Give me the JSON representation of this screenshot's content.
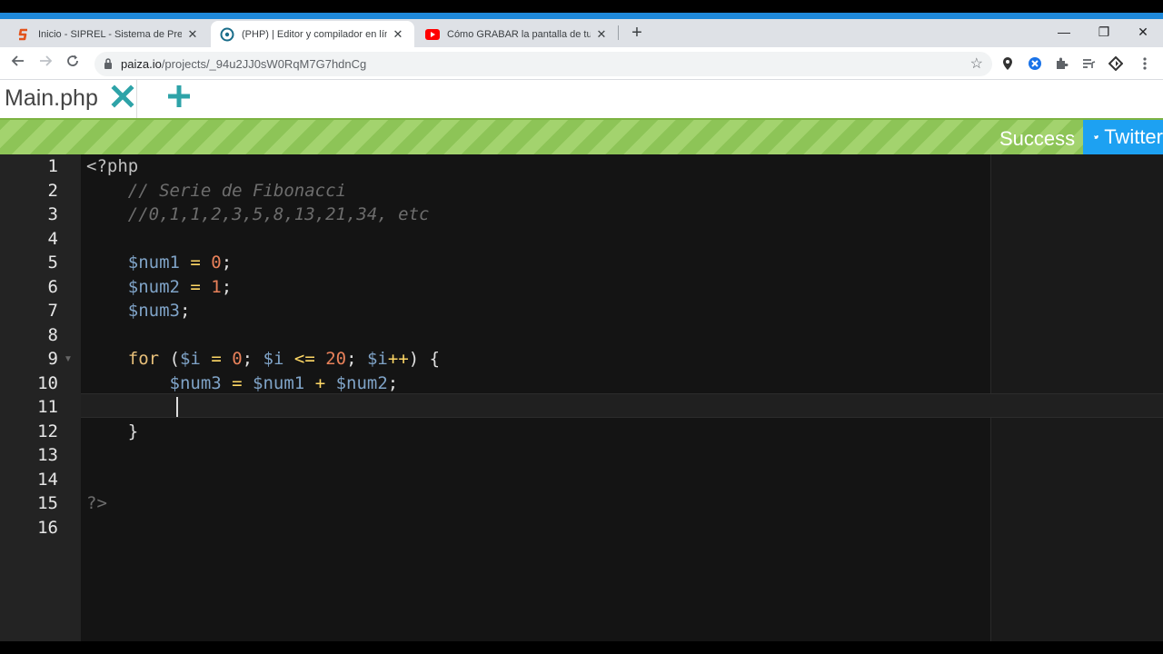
{
  "browser": {
    "tabs": [
      {
        "title": "Inicio - SIPREL - Sistema de Prep",
        "close": "✕"
      },
      {
        "title": "(PHP) | Editor y compilador en lín",
        "close": "✕"
      },
      {
        "title": "Cómo GRABAR la pantalla de tu",
        "close": "✕"
      }
    ],
    "new_tab": "+",
    "url_domain": "paiza.io",
    "url_path": "/projects/_94u2JJ0sW0RqM7G7hdnCg",
    "controls": {
      "minimize": "—",
      "restore": "❐",
      "close": "✕"
    }
  },
  "editor": {
    "file_name": "Main.php",
    "status": "Success",
    "twitter_label": "Twitter",
    "line_numbers": [
      "1",
      "2",
      "3",
      "4",
      "5",
      "6",
      "7",
      "8",
      "9",
      "10",
      "11",
      "12",
      "13",
      "14",
      "15",
      "16"
    ],
    "code": {
      "l1": "<?php",
      "l2": "    // Serie de Fibonacci",
      "l3": "    //0,1,1,2,3,5,8,13,21,34, etc",
      "l5_var": "$num1",
      "l5_op": " = ",
      "l5_num": "0",
      "l5_end": ";",
      "l6_var": "$num2",
      "l6_op": " = ",
      "l6_num": "1",
      "l6_end": ";",
      "l7_var": "$num3",
      "l7_end": ";",
      "l9_kw": "for",
      "l9_a": " (",
      "l9_v1": "$i",
      "l9_o1": " = ",
      "l9_n1": "0",
      "l9_b": "; ",
      "l9_v2": "$i",
      "l9_o2": " <= ",
      "l9_n2": "20",
      "l9_c": "; ",
      "l9_v3": "$i",
      "l9_o3": "++",
      "l9_d": ") {",
      "l10_v1": "$num3",
      "l10_o1": " = ",
      "l10_v2": "$num1",
      "l10_o2": " + ",
      "l10_v3": "$num2",
      "l10_end": ";",
      "l12": "    }",
      "l15": "?>"
    }
  }
}
